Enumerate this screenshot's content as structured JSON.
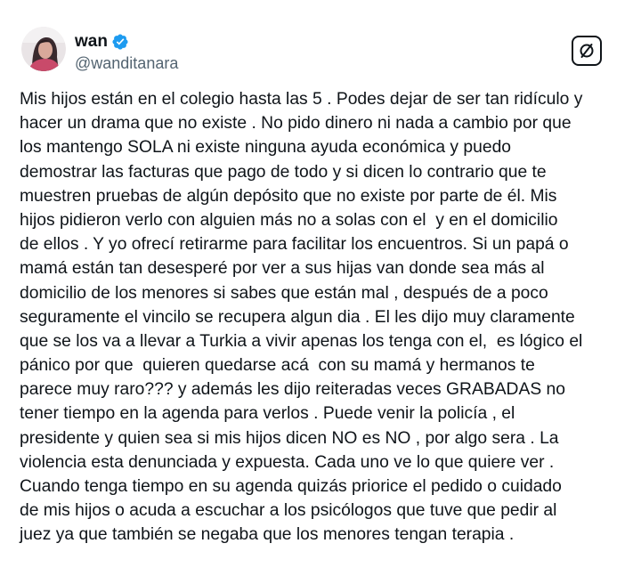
{
  "tweet": {
    "author": {
      "display_name": "wan",
      "handle": "@wanditanara",
      "verified": true,
      "verified_color": "#1d9bf0"
    },
    "header_icons": {
      "avatar": "avatar-photo",
      "verified": "verified-badge-icon",
      "action": "grok-slash-icon"
    },
    "text_lines": [
      "Mis hijos están en el colegio hasta las 5 . Podes dejar de ser tan ridículo y",
      "hacer un drama que no existe . No pido dinero ni nada a cambio por que",
      "los mantengo SOLA ni existe ninguna ayuda económica y puedo",
      "demostrar las facturas que pago de todo y si dicen lo contrario que te",
      "muestren pruebas de algún depósito que no existe por parte de él. Mis",
      "hijos pidieron verlo con alguien más no a solas con el  y en el domicilio",
      "de ellos . Y yo ofrecí retirarme para facilitar los encuentros. Si un papá o",
      "mamá están tan desesperé por ver a sus hijas van donde sea más al",
      "domicilio de los menores si sabes que están mal , después de a poco",
      "seguramente el vincilo se recupera algun dia . El les dijo muy claramente",
      "que se los va a llevar a Turkia a vivir apenas los tenga con el,  es lógico el",
      "pánico por que  quieren quedarse acá  con su mamá y hermanos te",
      "parece muy raro??? y además les dijo reiteradas veces GRABADAS no",
      "tener tiempo en la agenda para verlos . Puede venir la policía , el",
      "presidente y quien sea si mis hijos dicen NO es NO , por algo sera . La",
      "violencia esta denunciada y expuesta. Cada uno ve lo que quiere ver .",
      "Cuando tenga tiempo en su agenda quizás priorice el pedido o cuidado",
      "de mis hijos o acuda a escuchar a los psicólogos que tuve que pedir al",
      "juez ya que también se negaba que los menores tengan terapia ."
    ]
  }
}
